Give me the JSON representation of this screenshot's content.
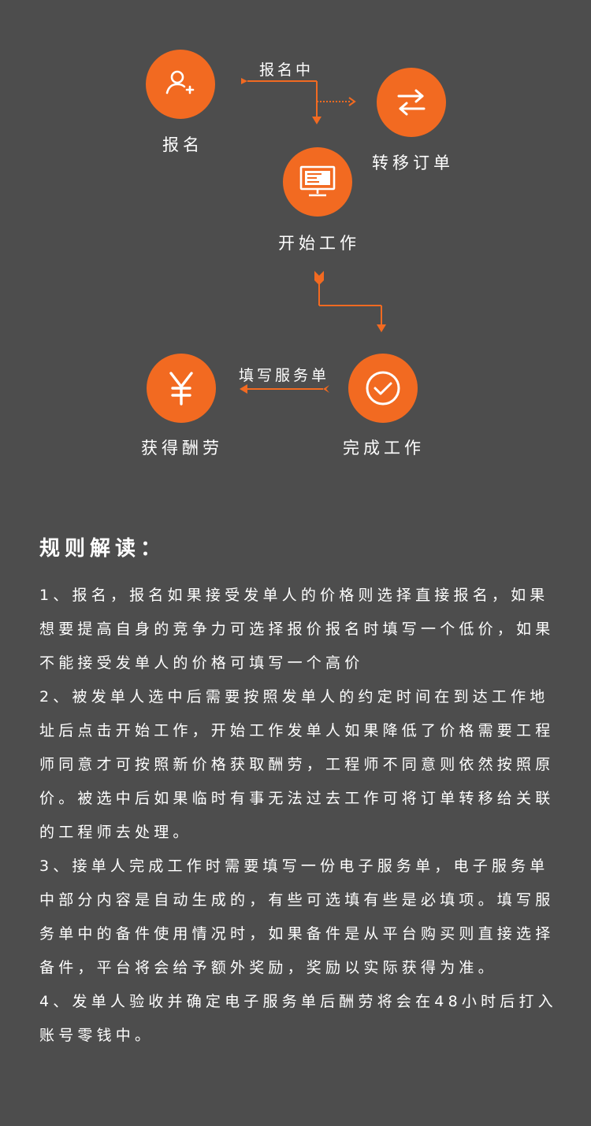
{
  "flow": {
    "signup": {
      "label": "报名",
      "icon": "user-add-icon"
    },
    "transfer": {
      "label": "转移订单",
      "icon": "swap-arrows-icon"
    },
    "start": {
      "label": "开始工作",
      "icon": "monitor-icon"
    },
    "complete": {
      "label": "完成工作",
      "icon": "check-circle-icon"
    },
    "reward": {
      "label": "获得酬劳",
      "icon": "yen-icon"
    },
    "arrow_signing_up": "报名中",
    "arrow_fill_form": "填写服务单"
  },
  "rules": {
    "title": "规则解读：",
    "items": [
      "1、报名，报名如果接受发单人的价格则选择直接报名，如果想要提高自身的竞争力可选择报价报名时填写一个低价，如果不能接受发单人的价格可填写一个高价",
      "2、被发单人选中后需要按照发单人的约定时间在到达工作地址后点击开始工作，开始工作发单人如果降低了价格需要工程师同意才可按照新价格获取酬劳，工程师不同意则依然按照原价。被选中后如果临时有事无法过去工作可将订单转移给关联的工程师去处理。",
      "3、接单人完成工作时需要填写一份电子服务单，电子服务单中部分内容是自动生成的，有些可选填有些是必填项。填写服务单中的备件使用情况时，如果备件是从平台购买则直接选择备件，平台将会给予额外奖励，奖励以实际获得为准。",
      "4、发单人验收并确定电子服务单后酬劳将会在48小时后打入账号零钱中。"
    ]
  },
  "colors": {
    "background": "#4d4d4d",
    "accent": "#f26a21",
    "text": "#ffffff"
  }
}
